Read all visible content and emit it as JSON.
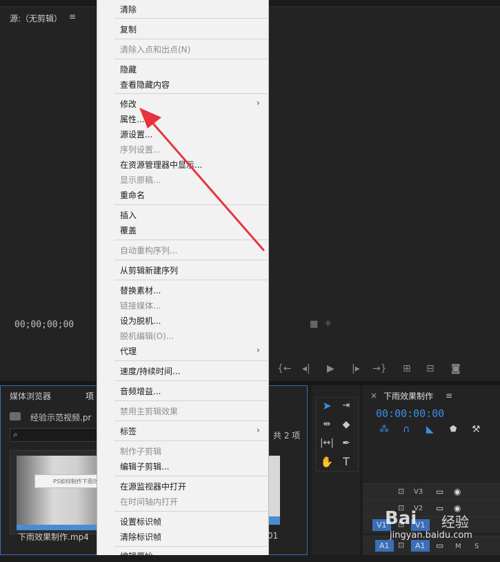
{
  "source_monitor": {
    "title": "源:（无剪辑）",
    "timecode": "00;00;00;00"
  },
  "project_panel": {
    "tab_media": "媒体浏览器",
    "tab_project": "项",
    "project_name": "经验示范视频.pr",
    "item_count": "共 2 项",
    "clip_name": "下雨效果制作.mp4",
    "thumb_label": "PS如何制作下雨效",
    "clip2_duration": "01"
  },
  "timeline": {
    "title": "下雨效果制作",
    "timecode": "00:00:00:00",
    "tracks": [
      "V3",
      "V2",
      "V1",
      "A1"
    ]
  },
  "context_menu": {
    "items": [
      {
        "label": "清除",
        "disabled": false
      },
      {
        "label": "复制",
        "disabled": false
      },
      {
        "label": "清除入点和出点(N)",
        "disabled": true
      },
      {
        "label": "隐藏",
        "disabled": false
      },
      {
        "label": "查看隐藏内容",
        "disabled": false
      },
      {
        "label": "修改",
        "disabled": false,
        "submenu": true
      },
      {
        "label": "属性...",
        "disabled": false
      },
      {
        "label": "源设置...",
        "disabled": false
      },
      {
        "label": "序列设置...",
        "disabled": true
      },
      {
        "label": "在资源管理器中显示...",
        "disabled": false
      },
      {
        "label": "显示原稿...",
        "disabled": true
      },
      {
        "label": "重命名",
        "disabled": false
      },
      {
        "label": "插入",
        "disabled": false
      },
      {
        "label": "覆盖",
        "disabled": false
      },
      {
        "label": "自动重构序列...",
        "disabled": true
      },
      {
        "label": "从剪辑新建序列",
        "disabled": false
      },
      {
        "label": "替换素材...",
        "disabled": false
      },
      {
        "label": "链接媒体...",
        "disabled": true
      },
      {
        "label": "设为脱机...",
        "disabled": false
      },
      {
        "label": "脱机编辑(O)...",
        "disabled": true
      },
      {
        "label": "代理",
        "disabled": false,
        "submenu": true
      },
      {
        "label": "速度/持续时间...",
        "disabled": false
      },
      {
        "label": "音频增益...",
        "disabled": false
      },
      {
        "label": "禁用主剪辑效果",
        "disabled": true
      },
      {
        "label": "标签",
        "disabled": false,
        "submenu": true
      },
      {
        "label": "制作子剪辑",
        "disabled": true
      },
      {
        "label": "编辑子剪辑...",
        "disabled": false
      },
      {
        "label": "在源监视器中打开",
        "disabled": false
      },
      {
        "label": "在时间轴内打开",
        "disabled": true
      },
      {
        "label": "设置标识帧",
        "disabled": false
      },
      {
        "label": "清除标识帧",
        "disabled": false
      },
      {
        "label": "编辑原始",
        "disabled": false
      }
    ]
  },
  "watermark": {
    "brand_a": "Bai",
    "brand_b": "经验",
    "url": "jingyan.baidu.com"
  },
  "colors": {
    "accent": "#3b8fe8",
    "annotation_arrow": "#e8323c"
  }
}
